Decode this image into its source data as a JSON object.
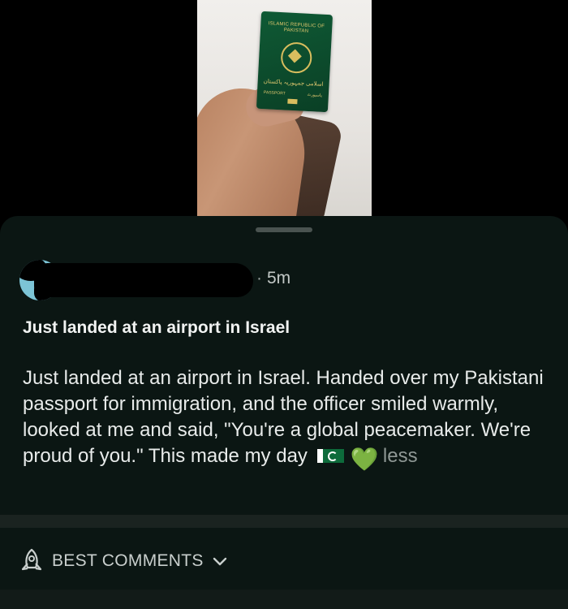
{
  "image": {
    "alt_icon": "passport-photo",
    "passport_header": "ISLAMIC REPUBLIC OF\nPAKISTAN",
    "passport_urdu": "اسلامی جمہوریہ پاکستان",
    "passport_label_en": "PASSPORT",
    "passport_label_ur": "پاسپورٹ"
  },
  "post": {
    "time": "5m",
    "title": "Just landed at an airport in Israel",
    "body": "Just landed at an airport in Israel. Handed over my Pakistani passport for immigration, and the officer smiled warmly, looked at me and said, \"You're a global peacemaker. We're proud of you.\" This made my day",
    "emoji_icons": [
      "pakistan-flag-icon",
      "green-heart-icon"
    ],
    "heart_glyph": "💚",
    "less_label": "less"
  },
  "comments": {
    "label": "BEST COMMENTS",
    "icon": "rocket-icon"
  },
  "colors": {
    "card_bg": "#0b1613",
    "accent_heart": "#3cd24e"
  }
}
